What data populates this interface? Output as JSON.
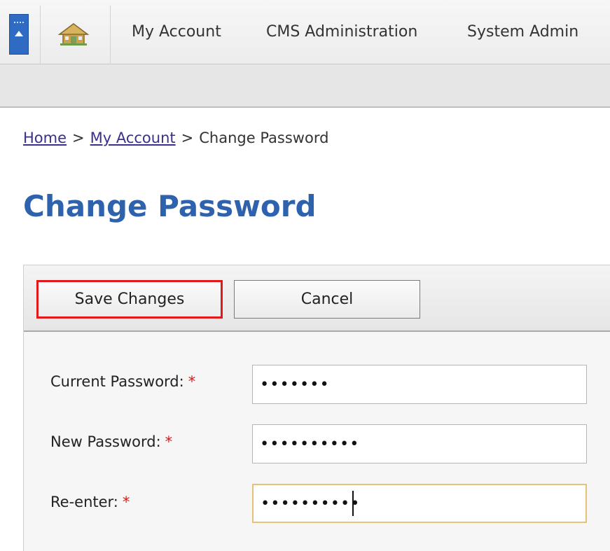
{
  "nav": {
    "items": [
      {
        "label": "My Account"
      },
      {
        "label": "CMS Administration"
      },
      {
        "label": "System Admin"
      }
    ],
    "collapse_icon": "collapse-up-icon",
    "home_icon": "home-icon"
  },
  "breadcrumb": {
    "home": "Home",
    "separator": ">",
    "my_account": "My Account",
    "current": "Change Password"
  },
  "page": {
    "title": "Change Password"
  },
  "toolbar": {
    "save_label": "Save Changes",
    "cancel_label": "Cancel"
  },
  "form": {
    "required_marker": "*",
    "fields": [
      {
        "label": "Current Password:",
        "value": "•••••••"
      },
      {
        "label": "New Password:",
        "value": "••••••••••"
      },
      {
        "label": "Re-enter:",
        "value": "••••••••••"
      }
    ]
  },
  "colors": {
    "accent_blue": "#2f62ad",
    "highlight_red": "#e0191b",
    "required_red": "#d11a1a",
    "focus_border": "#e4c27a"
  }
}
